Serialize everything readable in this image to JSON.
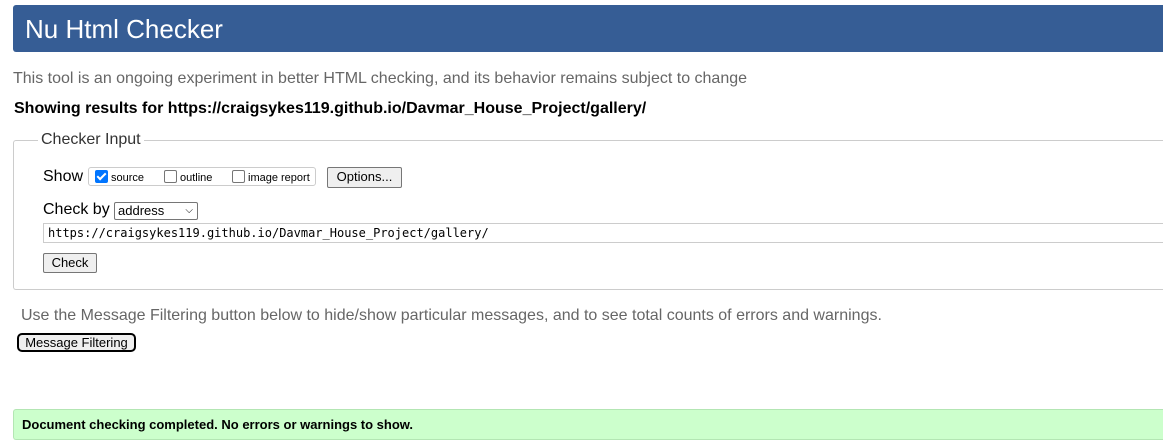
{
  "header": {
    "title": "Nu Html Checker"
  },
  "tagline": "This tool is an ongoing experiment in better HTML checking, and its behavior remains subject to change",
  "results_for": "Showing results for https://craigsykes119.github.io/Davmar_House_Project/gallery/",
  "checker_input": {
    "legend": "Checker Input",
    "show_label": "Show",
    "show_options": [
      {
        "label": "source",
        "checked": true
      },
      {
        "label": "outline",
        "checked": false
      },
      {
        "label": "image report",
        "checked": false
      }
    ],
    "options_button": "Options...",
    "check_by_label": "Check by",
    "check_by_value": "address",
    "url_value": "https://craigsykes119.github.io/Davmar_House_Project/gallery/",
    "check_button": "Check"
  },
  "filter": {
    "note": "Use the Message Filtering button below to hide/show particular messages, and to see total counts of errors and warnings.",
    "button": "Message Filtering"
  },
  "result": {
    "message": "Document checking completed. No errors or warnings to show."
  },
  "colors": {
    "header_bg": "#365d95",
    "success_bg": "#ccffcc",
    "checkbox_accent": "#0075ff"
  }
}
